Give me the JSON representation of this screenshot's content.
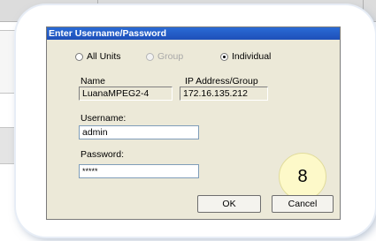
{
  "dialog": {
    "title": "Enter Username/Password",
    "scope_options": [
      {
        "label": "All Units",
        "selected": false,
        "enabled": true
      },
      {
        "label": "Group",
        "selected": false,
        "enabled": false
      },
      {
        "label": "Individual",
        "selected": true,
        "enabled": true
      }
    ],
    "name_label": "Name",
    "name_value": "LuanaMPEG2-4",
    "ip_label": "IP Address/Group",
    "ip_value": "172.16.135.212",
    "username_label": "Username:",
    "username_value": "admin",
    "password_label": "Password:",
    "password_value": "*****",
    "ok_label": "OK",
    "cancel_label": "Cancel"
  },
  "callout_number": "8"
}
